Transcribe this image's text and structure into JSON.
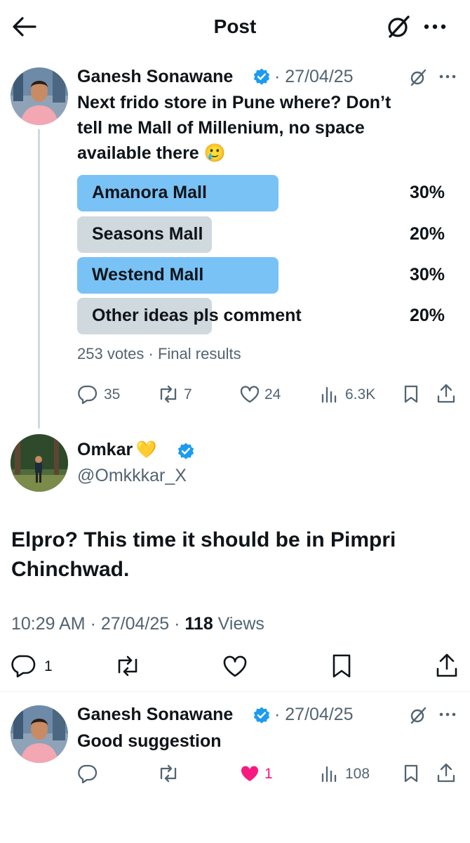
{
  "header": {
    "title": "Post"
  },
  "colors": {
    "accent": "#1d9bf0",
    "winner_bar": "#79c2f6",
    "other_bar": "#cfd9de",
    "like_pink": "#f91880",
    "muted": "#536471"
  },
  "tweet1": {
    "name": "Ganesh Sonawane",
    "meta": "· 27/04/25",
    "verified": true,
    "text_lines": [
      "Next frido store in Pune where? Don’t",
      "tell me Mall of Millenium, no space",
      "available there 🥲"
    ],
    "poll": {
      "options": [
        {
          "label": "Amanora Mall",
          "percent": "30%",
          "fraction": 0.3,
          "winner": true
        },
        {
          "label": "Seasons Mall",
          "percent": "20%",
          "fraction": 0.2,
          "winner": false
        },
        {
          "label": "Westend Mall",
          "percent": "30%",
          "fraction": 0.3,
          "winner": true
        },
        {
          "label": "Other ideas pls comment",
          "percent": "20%",
          "fraction": 0.2,
          "winner": false
        }
      ],
      "votes": "253 votes",
      "status": "· Final results"
    },
    "actions": {
      "replies": "35",
      "reposts": "7",
      "likes": "24",
      "views": "6.3K"
    }
  },
  "reply": {
    "name": "Omkar",
    "emoji": "💛",
    "handle": "@Omkkkar_X",
    "verified": true,
    "text_lines": [
      "Elpro? This time it should be in Pimpri",
      "Chinchwad."
    ],
    "time": "10:29 AM · 27/04/25 · ",
    "views_count": "118",
    "views_label": " Views",
    "actions": {
      "replies": "1"
    }
  },
  "tweet3": {
    "name": "Ganesh Sonawane",
    "meta": "· 27/04/25",
    "verified": true,
    "text": "Good suggestion",
    "actions": {
      "likes": "1",
      "views": "108"
    }
  },
  "icons": [
    "back-arrow-icon",
    "grok-icon",
    "more-icon",
    "verified-badge-icon",
    "reply-icon",
    "repost-icon",
    "like-icon",
    "views-icon",
    "bookmark-icon",
    "share-icon"
  ]
}
